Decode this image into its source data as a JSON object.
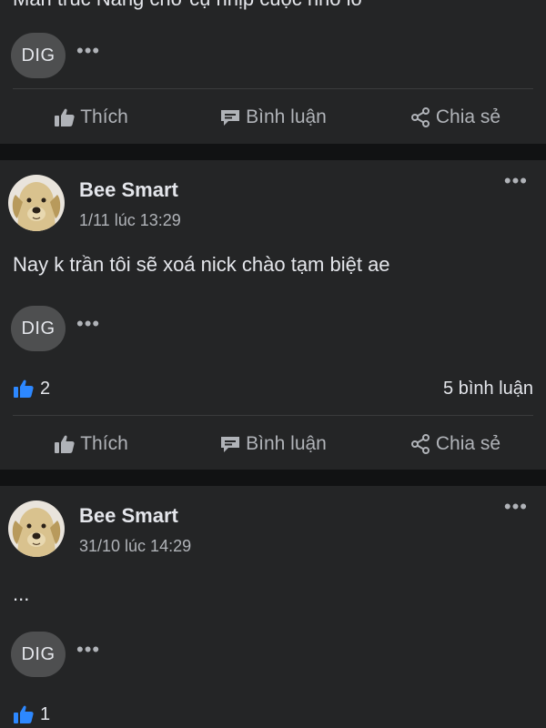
{
  "post0": {
    "cut_text": "Mần trúc Nàng chờ cụ nhịp cuộc nhỏ lỡ",
    "dig_label": "DIG",
    "more_label": "•••"
  },
  "actions": {
    "like": "Thích",
    "comment": "Bình luận",
    "share": "Chia sẻ"
  },
  "post1": {
    "author": "Bee Smart",
    "time": "1/11 lúc 13:29",
    "body": "Nay k trần tôi sẽ xoá nick chào tạm biệt ae",
    "dig_label": "DIG",
    "more_label": "•••",
    "options_label": "•••",
    "likes": "2",
    "comments": "5 bình luận"
  },
  "post2": {
    "author": "Bee Smart",
    "time": "31/10 lúc 14:29",
    "body": "...",
    "dig_label": "DIG",
    "more_label": "•••",
    "options_label": "•••",
    "likes": "1"
  },
  "colors": {
    "background": "#18191a",
    "card": "#242526",
    "text": "#e4e6eb",
    "secondary_text": "#b0b3b8",
    "like_blue": "#2d88ff"
  },
  "icons": [
    "thumbs-up-icon",
    "comment-icon",
    "share-icon",
    "like-reaction-icon",
    "more-dots-icon"
  ]
}
